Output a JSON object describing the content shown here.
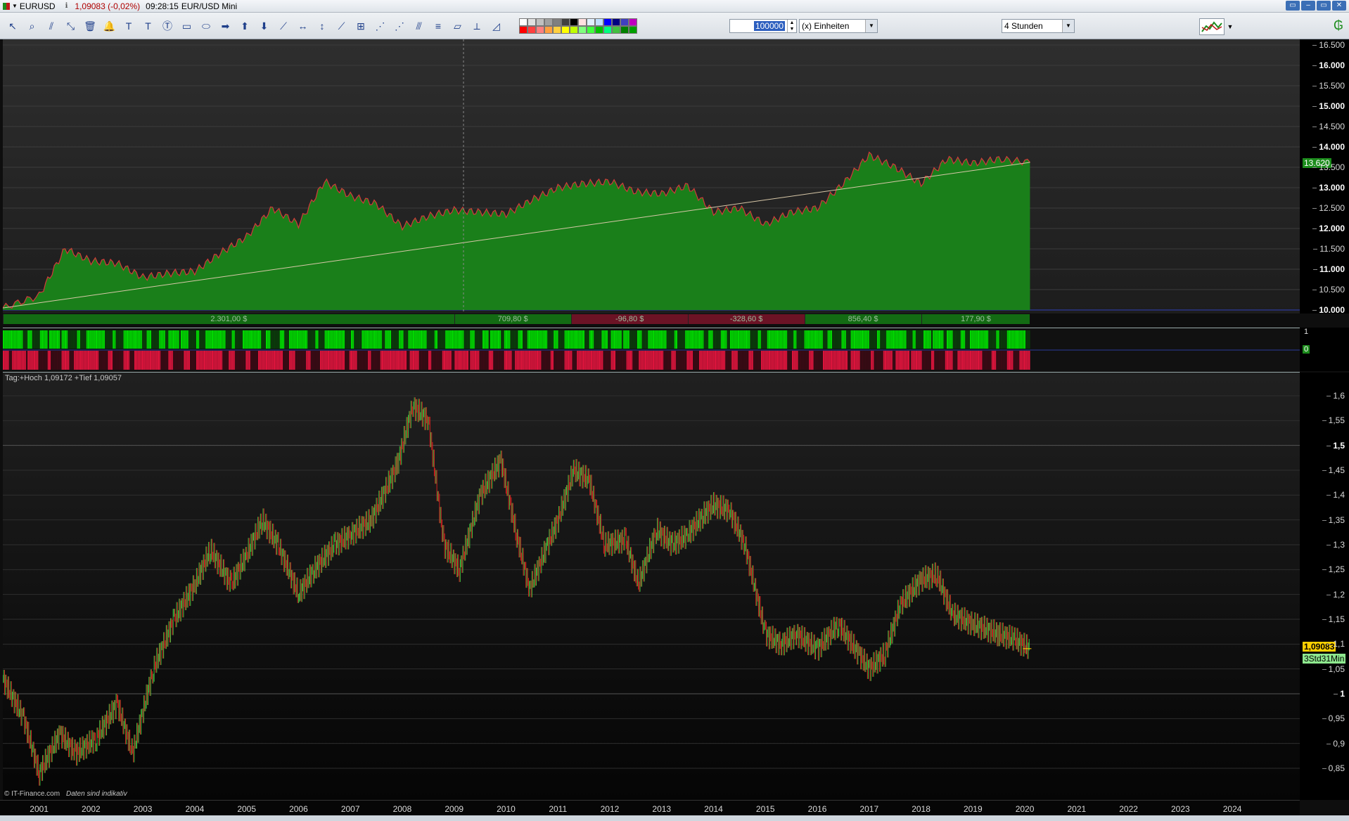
{
  "titlebar": {
    "symbol": "EURUSD",
    "quote": "1,09083 (-0,02%)",
    "time": "09:28:15",
    "name": "EUR/USD Mini",
    "window_buttons": [
      "▭",
      "–",
      "▭",
      "✕"
    ]
  },
  "toolbar": {
    "icons": [
      "cursor-icon",
      "zoom-icon",
      "trendline-icon",
      "draw-line-icon",
      "trash-icon",
      "alarm-bell-icon",
      "text-icon",
      "text-box-icon",
      "text-bubble-icon",
      "rectangle-icon",
      "polygon-icon",
      "arrow-right-icon",
      "arrow-up-icon",
      "arrow-down-icon",
      "ray-icon",
      "horizontal-line-icon",
      "vertical-line-icon",
      "channel-icon",
      "regression-icon",
      "fibonacci-icon",
      "gann-icon",
      "pitchfork-icon",
      "fib-levels-icon",
      "measure-icon",
      "angle-icon",
      "triangle-icon"
    ],
    "icon_glyphs": [
      "↖",
      "⌕",
      "⫽",
      "⤡",
      "🗑",
      "🔔",
      "T",
      "T",
      "Ⓣ",
      "▭",
      "⬭",
      "➡",
      "⬆",
      "⬇",
      "⟋",
      "↔",
      "↕",
      "⟋",
      "⊞",
      "⋰",
      "⋰",
      "⫻",
      "≡",
      "▱",
      "⟂",
      "◿"
    ],
    "colors": [
      "#ffffff",
      "#e0e0e0",
      "#c0c0c0",
      "#a0a0a0",
      "#808080",
      "#404040",
      "#000000",
      "#ffe0e0",
      "#e0f0ff",
      "#c0e0ff",
      "#0000ff",
      "#000080",
      "#4040c0",
      "#c000c0",
      "#ff0000",
      "#ff4040",
      "#ff8080",
      "#ffa040",
      "#ffd040",
      "#ffff00",
      "#c0ff00",
      "#80ff80",
      "#40ff40",
      "#00c000",
      "#00ff80",
      "#40c040",
      "#008000",
      "#00a000"
    ],
    "quantity": "100000",
    "unit_select": "(x) Einheiten",
    "interval_select": "4 Stunden"
  },
  "equity_axis": {
    "ticks": [
      "16.500",
      "16.000",
      "15.500",
      "15.000",
      "14.500",
      "14.000",
      "13.500",
      "13.000",
      "12.500",
      "12.000",
      "11.500",
      "11.000",
      "10.500",
      "10.000"
    ],
    "current": "13.620"
  },
  "pl_bar": {
    "segments": [
      {
        "label": "2.301,00 $",
        "positive": true
      },
      {
        "label": "709,80 $",
        "positive": true
      },
      {
        "label": "-96,80 $",
        "positive": false
      },
      {
        "label": "-328,60 $",
        "positive": false
      },
      {
        "label": "856,40 $",
        "positive": true
      },
      {
        "label": "177,90 $",
        "positive": true
      }
    ]
  },
  "signal_axis": {
    "top": "1",
    "zero": "0"
  },
  "price_panel": {
    "info": "Tag:+Hoch 1,09172 +Tief 1,09057",
    "copyright": "© IT-Finance.com",
    "disclaimer": "Daten sind indikativ"
  },
  "price_axis": {
    "ticks": [
      "1,6",
      "1,55",
      "1,5",
      "1,45",
      "1,4",
      "1,35",
      "1,3",
      "1,25",
      "1,2",
      "1,15",
      "1,1",
      "1,05",
      "1",
      "0,95",
      "0,9",
      "0,85"
    ],
    "current_price": "1,09083",
    "countdown": "3Std31Min"
  },
  "x_axis": {
    "years": [
      "2001",
      "2002",
      "2003",
      "2004",
      "2005",
      "2006",
      "2007",
      "2008",
      "2009",
      "2010",
      "2011",
      "2012",
      "2013",
      "2014",
      "2015",
      "2016",
      "2017",
      "2018",
      "2019",
      "2020",
      "2021",
      "2022",
      "2023",
      "2024"
    ]
  },
  "chart_data": [
    {
      "type": "area",
      "title": "",
      "x": [
        2000.3,
        2001.0,
        2001.5,
        2002.0,
        2002.5,
        2003.0,
        2003.5,
        2004.0,
        2004.5,
        2005.0,
        2005.5,
        2006.0,
        2006.5,
        2007.0,
        2007.5,
        2008.0,
        2008.5,
        2009.0,
        2009.5,
        2010.0,
        2010.5,
        2011.0,
        2011.5,
        2012.0,
        2012.5,
        2013.0,
        2013.5,
        2014.0,
        2014.5,
        2015.0,
        2015.5,
        2016.0,
        2016.5,
        2017.0,
        2017.5,
        2018.0,
        2018.5,
        2019.0,
        2019.5,
        2020.1
      ],
      "values": [
        10050,
        10350,
        11500,
        11200,
        11150,
        10800,
        10900,
        10950,
        11400,
        11800,
        12500,
        12100,
        13150,
        12800,
        12600,
        12050,
        12300,
        12450,
        12400,
        12350,
        12700,
        13000,
        13100,
        13150,
        12900,
        12850,
        13050,
        12400,
        12500,
        12100,
        12400,
        12500,
        13100,
        13800,
        13500,
        13100,
        13700,
        13600,
        13700,
        13620
      ],
      "trendline": [
        [
          2000.3,
          10050
        ],
        [
          2020.1,
          13620
        ]
      ],
      "ylim": [
        10000,
        16500
      ]
    },
    {
      "type": "line",
      "title": "",
      "x": [
        2000.3,
        2000.7,
        2001.0,
        2001.4,
        2001.7,
        2002.1,
        2002.5,
        2002.8,
        2003.2,
        2003.6,
        2004.0,
        2004.3,
        2004.7,
        2005.0,
        2005.3,
        2005.6,
        2006.0,
        2006.3,
        2006.7,
        2007.0,
        2007.4,
        2007.9,
        2008.2,
        2008.5,
        2008.8,
        2009.1,
        2009.5,
        2009.9,
        2010.2,
        2010.45,
        2010.8,
        2011.0,
        2011.3,
        2011.6,
        2011.9,
        2012.3,
        2012.55,
        2012.9,
        2013.2,
        2013.5,
        2013.8,
        2014.0,
        2014.3,
        2014.6,
        2015.0,
        2015.3,
        2015.6,
        2016.0,
        2016.4,
        2016.8,
        2017.0,
        2017.3,
        2017.6,
        2018.0,
        2018.3,
        2018.6,
        2019.0,
        2019.5,
        2019.8,
        2020.1
      ],
      "values": [
        1.03,
        0.95,
        0.84,
        0.92,
        0.88,
        0.91,
        0.98,
        0.88,
        1.05,
        1.15,
        1.22,
        1.29,
        1.22,
        1.28,
        1.35,
        1.3,
        1.2,
        1.25,
        1.3,
        1.32,
        1.35,
        1.46,
        1.58,
        1.55,
        1.3,
        1.25,
        1.4,
        1.47,
        1.32,
        1.21,
        1.3,
        1.35,
        1.45,
        1.43,
        1.3,
        1.31,
        1.22,
        1.33,
        1.3,
        1.32,
        1.36,
        1.38,
        1.37,
        1.3,
        1.12,
        1.1,
        1.12,
        1.09,
        1.14,
        1.08,
        1.05,
        1.08,
        1.18,
        1.23,
        1.24,
        1.16,
        1.14,
        1.12,
        1.11,
        1.09
      ],
      "ylim": [
        0.8,
        1.6
      ]
    }
  ]
}
